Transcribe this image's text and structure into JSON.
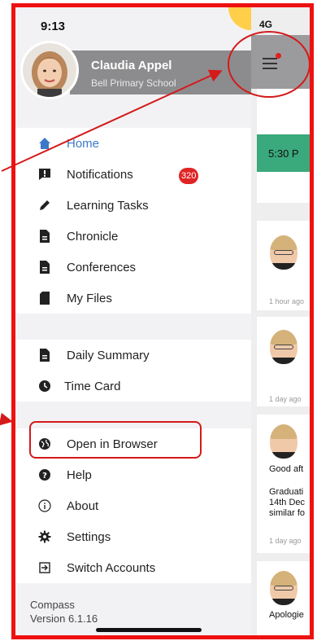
{
  "status": {
    "time": "9:13",
    "signal": "4G"
  },
  "profile": {
    "name": "Claudia Appel",
    "school": "Bell Primary School"
  },
  "menu": {
    "primary": [
      {
        "label": "Home",
        "icon": "home-icon",
        "active": true
      },
      {
        "label": "Notifications",
        "icon": "notification-icon",
        "badge": "320"
      },
      {
        "label": "Learning Tasks",
        "icon": "pencil-icon"
      },
      {
        "label": "Chronicle",
        "icon": "document-icon"
      },
      {
        "label": "Conferences",
        "icon": "document-icon"
      },
      {
        "label": "My Files",
        "icon": "sd-card-icon"
      }
    ],
    "secondary": [
      {
        "label": "Daily Summary",
        "icon": "document-icon"
      },
      {
        "label": "Time Card",
        "icon": "clock-icon"
      }
    ],
    "tertiary": [
      {
        "label": "Open in Browser",
        "icon": "globe-icon"
      },
      {
        "label": "Help",
        "icon": "help-icon"
      },
      {
        "label": "About",
        "icon": "info-icon"
      },
      {
        "label": "Settings",
        "icon": "gear-icon"
      },
      {
        "label": "Switch Accounts",
        "icon": "switch-accounts-icon"
      }
    ]
  },
  "footer": {
    "app_name": "Compass",
    "version": "Version 6.1.16"
  },
  "content": {
    "tile_time": "5:30 P",
    "feed": [
      {
        "ago": "1 hour ago"
      },
      {
        "ago": "1 day ago"
      },
      {
        "text_1": "Good aft",
        "text_2": "Graduati",
        "text_3": "14th Dec",
        "text_4": "similar fo",
        "ago": "1 day ago"
      },
      {
        "text_1": "Apologie"
      }
    ]
  },
  "colors": {
    "accent": "#3c79c8",
    "badge": "#e02424",
    "annotation": "#d41a1a",
    "tile": "#3aa97b"
  }
}
